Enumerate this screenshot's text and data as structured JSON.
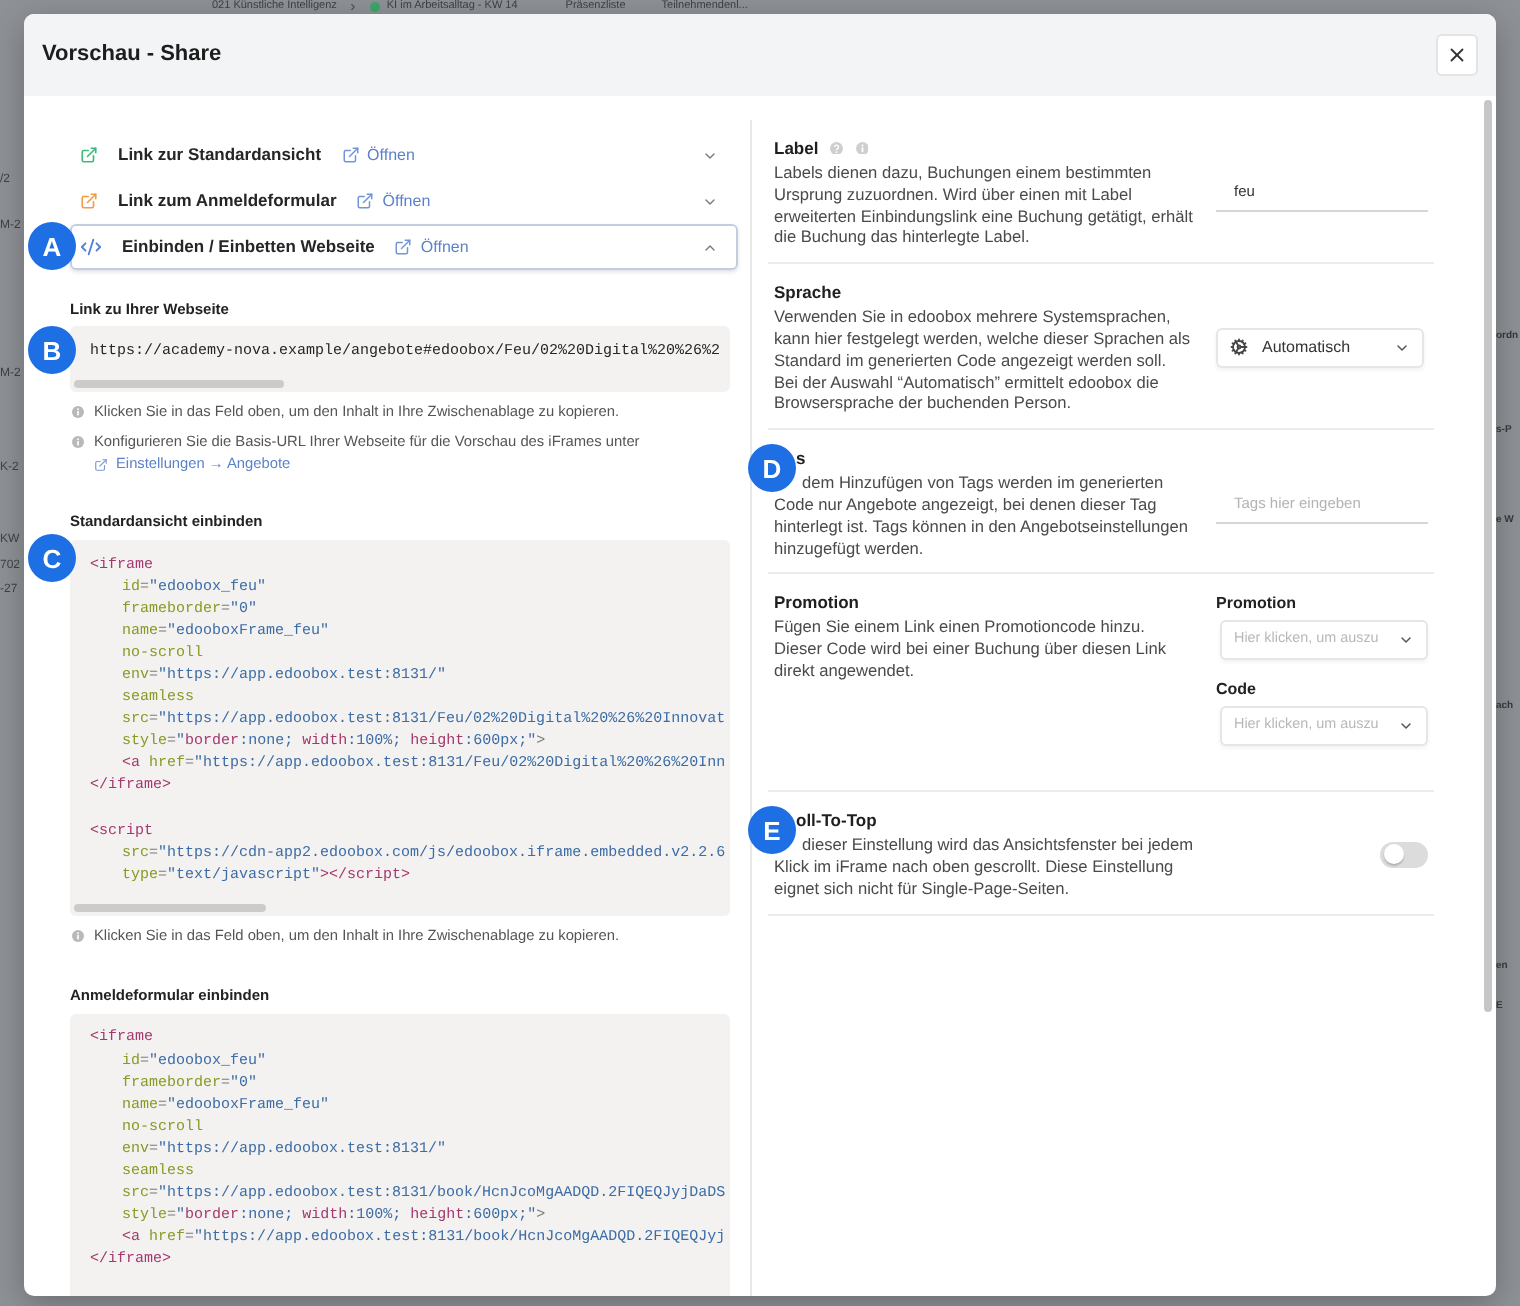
{
  "background": {
    "breadcrumbs": [
      {
        "text": "021 Künstliche Intelligenz"
      },
      {
        "text": "KI im Arbeitsalltag - KW 14",
        "color": "#3aa86b"
      }
    ],
    "tabs": [
      {
        "label": "Präsenzliste"
      },
      {
        "label": "Teilnehmendenl..."
      }
    ],
    "left_fragments": [
      "/2",
      "M-2",
      "M-2",
      "K-2",
      "KW",
      "702",
      "-27"
    ],
    "right_fragments": [
      "ordn",
      "s-P",
      "e W",
      "ach",
      "en",
      "E"
    ]
  },
  "dialog": {
    "title": "Vorschau - Share"
  },
  "accordion": [
    {
      "kind": "link",
      "title": "Link zur Standardansicht",
      "color": "#3dba7c",
      "open_link": "Öffnen",
      "expanded": false
    },
    {
      "kind": "link",
      "title": "Link zum Anmeldeformular",
      "color": "#f29b48",
      "open_link": "Öffnen",
      "expanded": false
    },
    {
      "kind": "embed",
      "title": "Einbinden / Einbetten Webseite",
      "color": "#4f7fd6",
      "open_link": "Öffnen",
      "expanded": true,
      "annotation": "A"
    }
  ],
  "embed": {
    "url_field": {
      "label": "Link zu Ihrer Webseite",
      "value": "https://academy-nova.example/angebote#edoobox/Feu/02%20Digital%20%26%2",
      "annotation": "B"
    },
    "hints": [
      {
        "text": "Klicken Sie in das Feld oben, um den Inhalt in Ihre Zwischenablage zu kopieren."
      },
      {
        "text": "Konfigurieren Sie die Basis-URL Ihrer Webseite für die Vorschau des iFrames unter",
        "link": "Einstellungen → Angebote"
      }
    ],
    "code_sections": [
      {
        "title": "Standardansicht einbinden",
        "annotation": "C",
        "hint": "Klicken Sie in das Feld oben, um den Inhalt in Ihre Zwischenablage zu kopieren.",
        "elements": [
          {
            "lines": [
              {
                "tokens": [
                  {
                    "kind": "tag",
                    "text": "<iframe"
                  }
                ],
                "children": [
                  {
                    "tokens": [
                      {
                        "kind": "attr",
                        "text": "id"
                      },
                      {
                        "kind": "punct",
                        "text": "="
                      },
                      {
                        "kind": "string",
                        "text": "\"edoobox_feu\""
                      }
                    ]
                  },
                  {
                    "tokens": [
                      {
                        "kind": "attr",
                        "text": "frameborder"
                      },
                      {
                        "kind": "punct",
                        "text": "="
                      },
                      {
                        "kind": "string",
                        "text": "\"0\""
                      }
                    ]
                  },
                  {
                    "tokens": [
                      {
                        "kind": "attr",
                        "text": "name"
                      },
                      {
                        "kind": "punct",
                        "text": "="
                      },
                      {
                        "kind": "string",
                        "text": "\"edooboxFrame_feu\""
                      }
                    ]
                  },
                  {
                    "tokens": [
                      {
                        "kind": "attr",
                        "text": "no-scroll"
                      }
                    ]
                  },
                  {
                    "tokens": [
                      {
                        "kind": "attr",
                        "text": "env"
                      },
                      {
                        "kind": "punct",
                        "text": "="
                      },
                      {
                        "kind": "string",
                        "text": "\"https://app.edoobox.test:8131/\""
                      }
                    ]
                  },
                  {
                    "tokens": [
                      {
                        "kind": "attr",
                        "text": "seamless"
                      }
                    ]
                  },
                  {
                    "tokens": [
                      {
                        "kind": "attr",
                        "text": "src"
                      },
                      {
                        "kind": "punct",
                        "text": "="
                      },
                      {
                        "kind": "string",
                        "text": "\"https://app.edoobox.test:8131/Feu/02%20Digital%20%26%20Innovat"
                      }
                    ]
                  },
                  {
                    "tokens": [
                      {
                        "kind": "attr",
                        "text": "style"
                      },
                      {
                        "kind": "punct",
                        "text": "="
                      },
                      {
                        "kind": "string",
                        "text": "\""
                      },
                      {
                        "kind": "prop",
                        "text": "border"
                      },
                      {
                        "kind": "string",
                        "text": ":none; "
                      },
                      {
                        "kind": "prop",
                        "text": "width"
                      },
                      {
                        "kind": "string",
                        "text": ":100%; "
                      },
                      {
                        "kind": "prop",
                        "text": "height"
                      },
                      {
                        "kind": "string",
                        "text": ":600px;\""
                      },
                      {
                        "kind": "punct",
                        "text": ">"
                      }
                    ]
                  },
                  {
                    "tokens": [
                      {
                        "kind": "tag",
                        "text": "<a "
                      },
                      {
                        "kind": "attr",
                        "text": "href"
                      },
                      {
                        "kind": "punct",
                        "text": "="
                      },
                      {
                        "kind": "string",
                        "text": "\"https://app.edoobox.test:8131/Feu/02%20Digital%20%26%20Inn"
                      }
                    ]
                  }
                ]
              },
              {
                "tokens": [
                  {
                    "kind": "tag",
                    "text": "</iframe>"
                  }
                ]
              }
            ]
          },
          {
            "lines": [
              {
                "tokens": [
                  {
                    "kind": "tag",
                    "text": "<script"
                  }
                ],
                "children": [
                  {
                    "tokens": [
                      {
                        "kind": "attr",
                        "text": "src"
                      },
                      {
                        "kind": "punct",
                        "text": "="
                      },
                      {
                        "kind": "string",
                        "text": "\"https://cdn-app2.edoobox.com/js/edoobox.iframe.embedded.v2.2.6"
                      }
                    ]
                  },
                  {
                    "tokens": [
                      {
                        "kind": "attr",
                        "text": "type"
                      },
                      {
                        "kind": "punct",
                        "text": "="
                      },
                      {
                        "kind": "string",
                        "text": "\"text/javascript\""
                      },
                      {
                        "kind": "tag",
                        "text": "></script>"
                      }
                    ]
                  }
                ]
              }
            ]
          }
        ]
      },
      {
        "title": "Anmeldeformular einbinden",
        "elements": [
          {
            "lines": [
              {
                "tokens": [
                  {
                    "kind": "tag",
                    "text": "<iframe"
                  }
                ],
                "children": [
                  {
                    "tokens": [
                      {
                        "kind": "attr",
                        "text": "id"
                      },
                      {
                        "kind": "punct",
                        "text": "="
                      },
                      {
                        "kind": "string",
                        "text": "\"edoobox_feu\""
                      }
                    ]
                  },
                  {
                    "tokens": [
                      {
                        "kind": "attr",
                        "text": "frameborder"
                      },
                      {
                        "kind": "punct",
                        "text": "="
                      },
                      {
                        "kind": "string",
                        "text": "\"0\""
                      }
                    ]
                  },
                  {
                    "tokens": [
                      {
                        "kind": "attr",
                        "text": "name"
                      },
                      {
                        "kind": "punct",
                        "text": "="
                      },
                      {
                        "kind": "string",
                        "text": "\"edooboxFrame_feu\""
                      }
                    ]
                  },
                  {
                    "tokens": [
                      {
                        "kind": "attr",
                        "text": "no-scroll"
                      }
                    ]
                  },
                  {
                    "tokens": [
                      {
                        "kind": "attr",
                        "text": "env"
                      },
                      {
                        "kind": "punct",
                        "text": "="
                      },
                      {
                        "kind": "string",
                        "text": "\"https://app.edoobox.test:8131/\""
                      }
                    ]
                  },
                  {
                    "tokens": [
                      {
                        "kind": "attr",
                        "text": "seamless"
                      }
                    ]
                  },
                  {
                    "tokens": [
                      {
                        "kind": "attr",
                        "text": "src"
                      },
                      {
                        "kind": "punct",
                        "text": "="
                      },
                      {
                        "kind": "string",
                        "text": "\"https://app.edoobox.test:8131/book/HcnJcoMgAADQD.2FIQEQJyjDaDS"
                      }
                    ]
                  },
                  {
                    "tokens": [
                      {
                        "kind": "attr",
                        "text": "style"
                      },
                      {
                        "kind": "punct",
                        "text": "="
                      },
                      {
                        "kind": "string",
                        "text": "\""
                      },
                      {
                        "kind": "prop",
                        "text": "border"
                      },
                      {
                        "kind": "string",
                        "text": ":none; "
                      },
                      {
                        "kind": "prop",
                        "text": "width"
                      },
                      {
                        "kind": "string",
                        "text": ":100%; "
                      },
                      {
                        "kind": "prop",
                        "text": "height"
                      },
                      {
                        "kind": "string",
                        "text": ":600px;\""
                      },
                      {
                        "kind": "punct",
                        "text": ">"
                      }
                    ]
                  },
                  {
                    "tokens": [
                      {
                        "kind": "tag",
                        "text": "<a "
                      },
                      {
                        "kind": "attr",
                        "text": "href"
                      },
                      {
                        "kind": "punct",
                        "text": "="
                      },
                      {
                        "kind": "string",
                        "text": "\"https://app.edoobox.test:8131/book/HcnJcoMgAADQD.2FIQEQJyj"
                      }
                    ]
                  }
                ]
              },
              {
                "tokens": [
                  {
                    "kind": "tag",
                    "text": "</iframe>"
                  }
                ]
              }
            ]
          }
        ]
      }
    ]
  },
  "settings": [
    {
      "kind": "text",
      "title": "Label",
      "description": "Labels dienen dazu, Buchungen einem bestimmten Ursprung zuzuordnen. Wird über einen mit Label erweiterten Einbindungslink eine Buchung getätigt, erhält die Buchung das hinterlegte Label.",
      "value": "feu"
    },
    {
      "kind": "select",
      "title": "Sprache",
      "description": "Verwenden Sie in edoobox mehrere Systemsprachen, kann hier festgelegt werden, welche dieser Sprachen als Standard im generierten Code angezeigt werden soll. Bei der Auswahl “Automatisch” ermittelt edoobox die Browsersprache der buchenden Person.",
      "value": "Automatisch"
    },
    {
      "kind": "tags",
      "title": "s",
      "description": "dem Hinzufügen von Tags werden im generierten Code nur Angebote angezeigt, bei denen dieser Tag hinterlegt ist. Tags können in den Angebotseinstellungen hinzugefügt werden.",
      "placeholder": "Tags hier eingeben",
      "annotation": "D"
    },
    {
      "kind": "selects",
      "title": "Promotion",
      "description": "Fügen Sie einem Link einen Promotioncode hinzu. Dieser Code wird bei einer Buchung über diesen Link direkt angewendet.",
      "fields": [
        {
          "label": "Promotion",
          "placeholder": "Hier klicken, um auszu"
        },
        {
          "label": "Code",
          "placeholder": "Hier klicken, um auszu"
        }
      ]
    },
    {
      "kind": "toggle",
      "title": "oll-To-Top",
      "description": "dieser Einstellung wird das Ansichtsfenster bei jedem Klick im iFrame nach oben gescrollt. Diese Einstellung eignet sich nicht für Single-Page-Seiten.",
      "on": false,
      "annotation": "E"
    }
  ]
}
